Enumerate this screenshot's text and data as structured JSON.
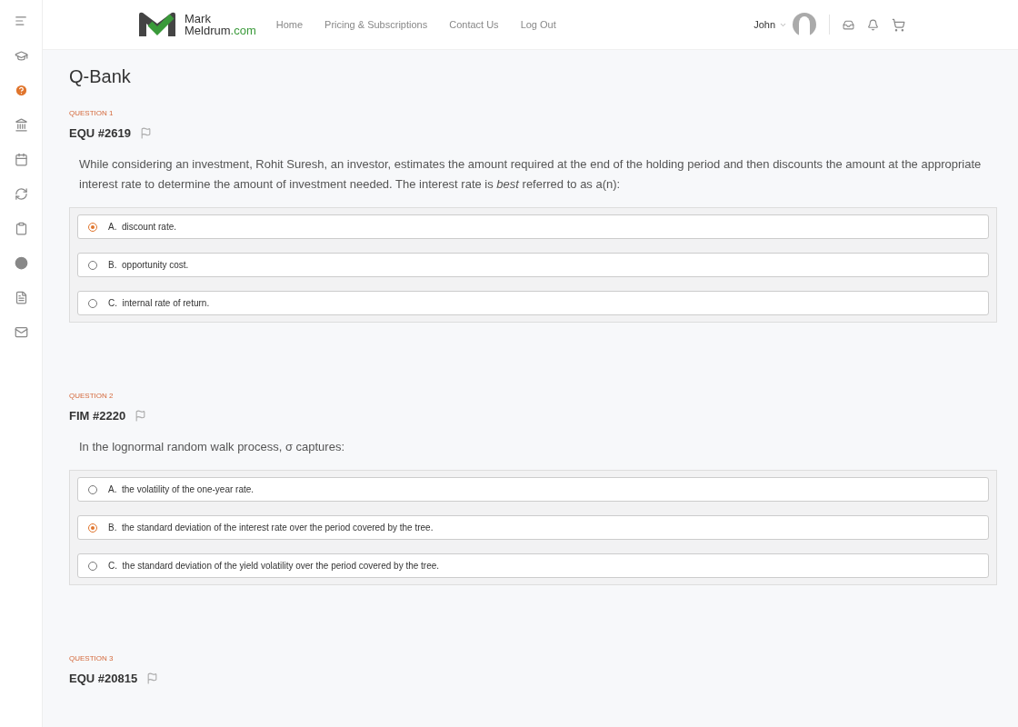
{
  "sidebar": {
    "items": [
      {
        "selected": false
      },
      {
        "selected": true
      },
      {
        "selected": false
      },
      {
        "selected": false
      },
      {
        "selected": false
      },
      {
        "selected": false
      },
      {
        "selected": false
      },
      {
        "selected": false
      },
      {
        "selected": false
      }
    ]
  },
  "header": {
    "logo": {
      "line1": "Mark",
      "line2": "Meldrum",
      "suffix": ".com"
    },
    "nav": [
      "Home",
      "Pricing & Subscriptions",
      "Contact Us",
      "Log Out"
    ],
    "user": "John"
  },
  "page": {
    "title": "Q-Bank"
  },
  "questions": [
    {
      "label": "QUESTION 1",
      "code": "EQU #2619",
      "text": "While considering an investment, Rohit Suresh, an investor, estimates the amount required at the end of the holding period and then discounts the amount at the appropriate interest rate to determine the amount of investment needed.  The interest rate is *best* referred to as a(n):",
      "options": [
        {
          "letter": "A.",
          "text": "discount rate.",
          "selected": true
        },
        {
          "letter": "B.",
          "text": "opportunity cost.",
          "selected": false
        },
        {
          "letter": "C.",
          "text": "internal rate of return.",
          "selected": false
        }
      ]
    },
    {
      "label": "QUESTION 2",
      "code": "FIM #2220",
      "text": "In the lognormal random walk process, σ captures:",
      "options": [
        {
          "letter": "A.",
          "text": "the volatility of the one-year rate.",
          "selected": false
        },
        {
          "letter": "B.",
          "text": "the standard deviation of the interest rate over the period covered by the tree.",
          "selected": true
        },
        {
          "letter": "C.",
          "text": "the standard deviation of the yield volatility over the period covered by the tree.",
          "selected": false
        }
      ]
    },
    {
      "label": "QUESTION 3",
      "code": "EQU #20815"
    }
  ]
}
